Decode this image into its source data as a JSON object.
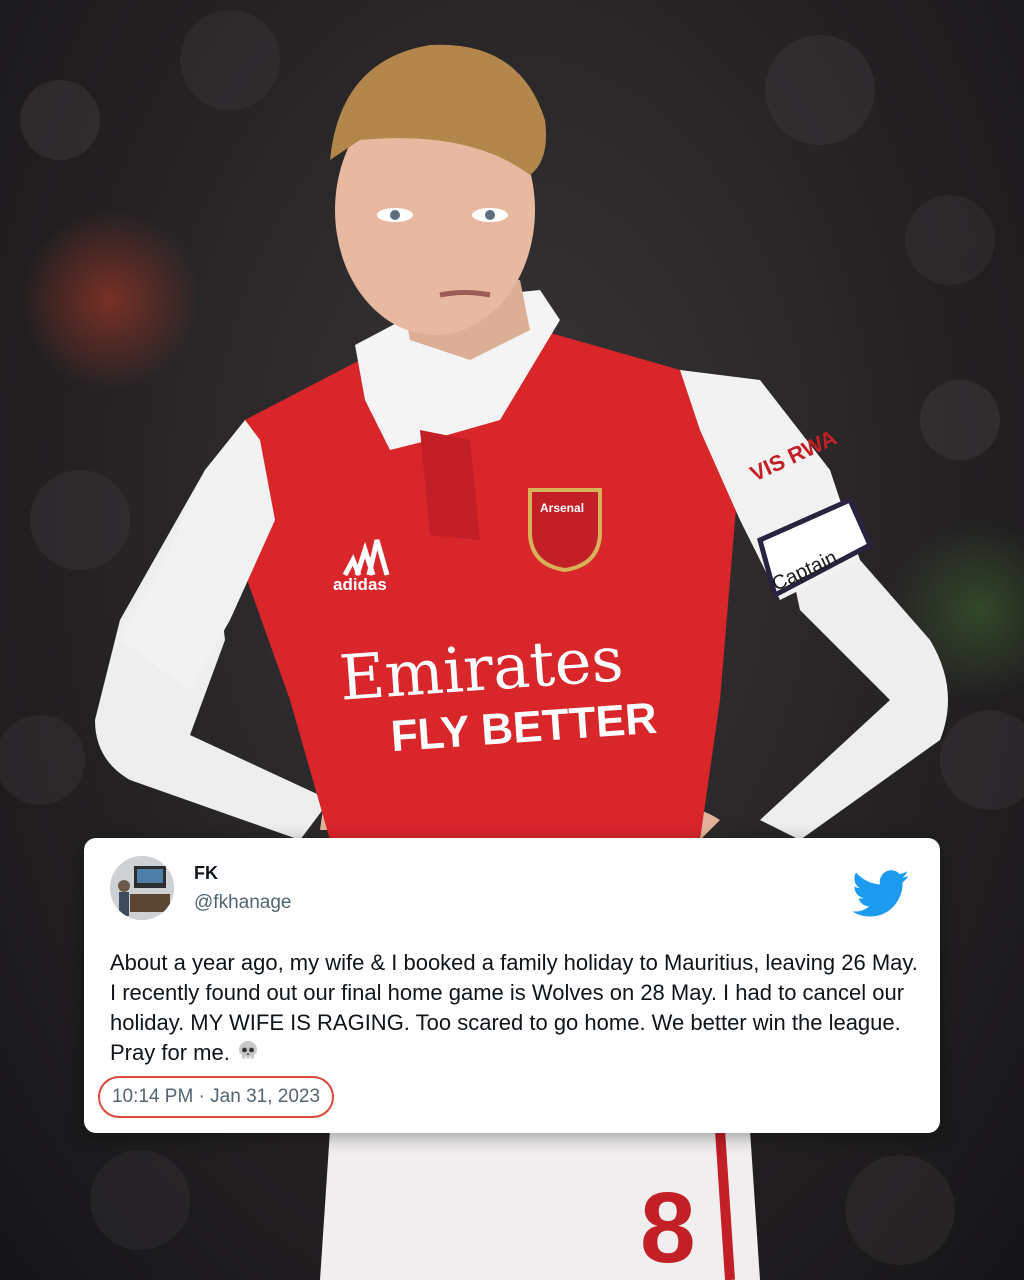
{
  "photo": {
    "subject": "footballer in red and white kit, hands on hips",
    "shirt_texts": [
      "Emirates",
      "FLY BETTER"
    ],
    "badge_text": "Arsenal",
    "armband_text": "Captain",
    "sleeve_sponsor": "VIS RWA",
    "kit_brand": "adidas",
    "shorts_number": "8",
    "colors": {
      "kit_red": "#d8262b",
      "kit_white": "#f2f2f2",
      "background": "#262325"
    }
  },
  "tweet": {
    "display_name": "FK",
    "handle": "@fkhanage",
    "text": "About a year ago, my wife & I booked a family holiday to Mauritius, leaving 26 May. I recently found out our final home game is Wolves on 28 May. I had to cancel our holiday. MY WIFE IS RAGING. Too scared to go home. We better win the league. Pray for me.",
    "emoji": "skull-emoji",
    "timestamp": "10:14 PM · Jan 31, 2023",
    "brand_icon": "twitter-bird-icon",
    "colors": {
      "brand": "#1d9bf0",
      "highlight": "#d9493c",
      "text": "#0f1419",
      "muted": "#536471"
    }
  }
}
